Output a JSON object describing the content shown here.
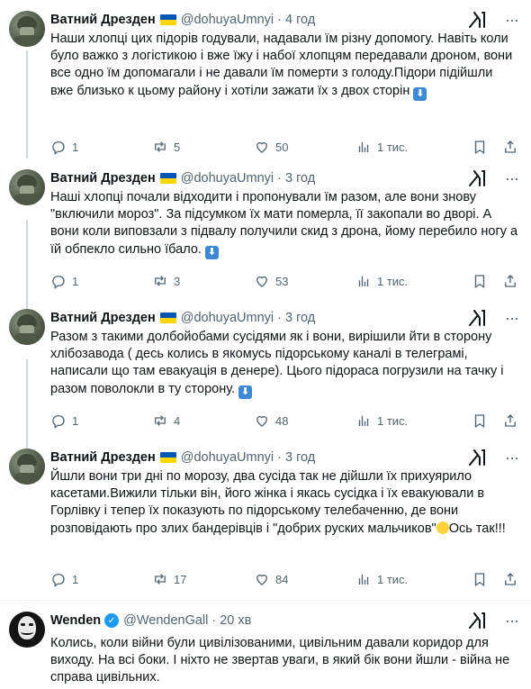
{
  "tweets": [
    {
      "name": "Ватний Дрезден",
      "handle": "@dohuyaUmnyi",
      "time": "4 год",
      "text": "Наши хлопці цих підорів годували, надавали їм різну допомогу. Навіть коли було важко з логістикою і вже їжу і набої хлопцям передавали дроном, вони все одно їм допомагали і не давали їм померти з голоду.Підори підійшли вже близько к цьому району і хотіли зажати їх з двох сторін",
      "stats": {
        "replies": "1",
        "reposts": "5",
        "likes": "50",
        "views": "1 тис."
      }
    },
    {
      "name": "Ватний Дрезден",
      "handle": "@dohuyaUmnyi",
      "time": "3 год",
      "text": "Наші хлопці почали відходити і пропонували їм разом, але вони знову \"включили мороз\". За підсумком їх мати померла, її закопали во дворі. А вони коли виповзали з підвалу получили скид з дрона, йому перебило ногу а їй обпекло сильно їбало.",
      "stats": {
        "replies": "1",
        "reposts": "3",
        "likes": "53",
        "views": "1 тис."
      }
    },
    {
      "name": "Ватний Дрезден",
      "handle": "@dohuyaUmnyi",
      "time": "3 год",
      "text": "Разом з такими долбойобами сусідями як і вони, вирішили йти в сторону хлібозавода ( десь колись в якомусь підорському каналі в телеграмі, написали що там евакуація в денере). Цього підораса погрузили на тачку і разом поволокли в ту сторону.",
      "stats": {
        "replies": "1",
        "reposts": "4",
        "likes": "48",
        "views": "1 тис."
      }
    },
    {
      "name": "Ватний Дрезден",
      "handle": "@dohuyaUmnyi",
      "time": "3 год",
      "text_before": "Йшли вони три дні по морозу, два сусіда так не дійшли їх прихуярило касетами.Вижили тільки він, його жінка і якась сусідка і їх евакуювали в Горлівку і тепер їх показують по підорському телебаченню, де вони розповідають про злих бандерівців і \"добрих руских мальчиков\"",
      "text_after": "Ось так!!!",
      "stats": {
        "replies": "1",
        "reposts": "17",
        "likes": "84",
        "views": "1 тис."
      }
    },
    {
      "name": "Wenden",
      "handle": "@WendenGall",
      "time": "20 хв",
      "text": "Колись, коли війни були цивілізованими, цивільним давали коридор для виходу. На всі боки. І ніхто не звертав уваги, в який бік вони йшли - війна не справа цивільних."
    }
  ],
  "icons": {
    "flag": "ukraine-flag-icon",
    "more": "more-options-icon",
    "grok": "grok-icon",
    "reply": "reply-icon",
    "repost": "repost-icon",
    "like": "like-icon",
    "views": "views-icon",
    "bookmark": "bookmark-icon",
    "share": "share-icon",
    "down_arrow_emoji": "down-arrow-emoji",
    "smile_emoji": "smile-emoji",
    "verified": "verified-badge-icon"
  },
  "colors": {
    "text": "#0f1419",
    "secondary": "#536471",
    "thread_line": "#cfd9de",
    "verified": "#1d9bf0",
    "divider": "#eff3f4"
  }
}
